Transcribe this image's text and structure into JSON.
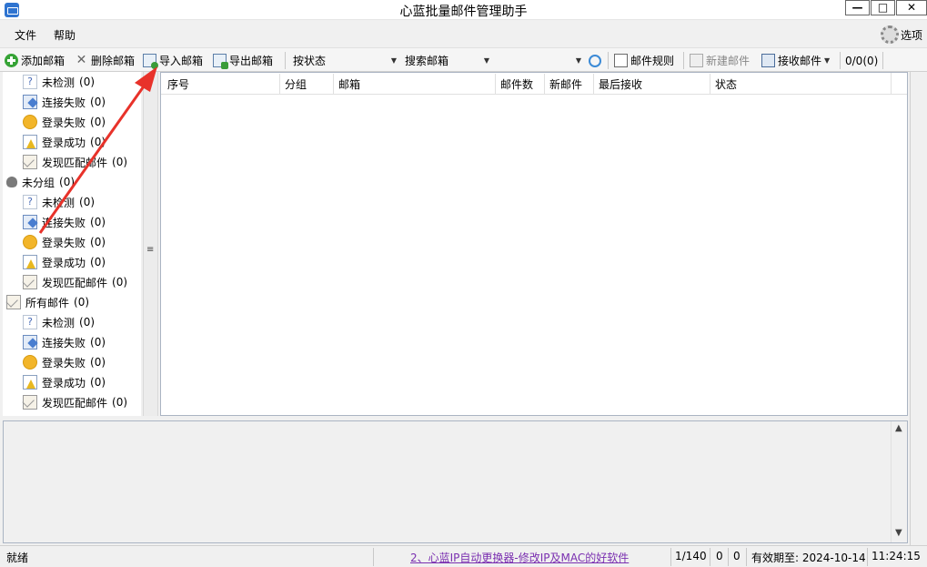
{
  "window": {
    "title": "心蓝批量邮件管理助手",
    "buttons": [
      "—",
      "□",
      "✕"
    ]
  },
  "menu": {
    "file": "文件",
    "help": "帮助",
    "options": "选项"
  },
  "toolbar": {
    "add_mailbox": "添加邮箱",
    "delete_mailbox": "删除邮箱",
    "import_mailbox": "导入邮箱",
    "export_mailbox": "导出邮箱",
    "status_filter": "按状态",
    "search_mailbox": "搜索邮箱",
    "search_value": "",
    "mail_rules": "邮件规则",
    "new_mail": "新建邮件",
    "receive_mail": "接收邮件",
    "count": "0/0(0)"
  },
  "tree": {
    "group1": [
      {
        "label": "未检测",
        "count": "(0)",
        "icon": "question-icon"
      },
      {
        "label": "连接失败",
        "count": "(0)",
        "icon": "link-icon"
      },
      {
        "label": "登录失败",
        "count": "(0)",
        "icon": "fail-icon"
      },
      {
        "label": "登录成功",
        "count": "(0)",
        "icon": "warning-icon"
      },
      {
        "label": "发现匹配邮件",
        "count": "(0)",
        "icon": "mail-icon"
      }
    ],
    "ungrouped": {
      "label": "未分组",
      "count": "(0)"
    },
    "group2": [
      {
        "label": "未检测",
        "count": "(0)",
        "icon": "question-icon"
      },
      {
        "label": "连接失败",
        "count": "(0)",
        "icon": "link-icon"
      },
      {
        "label": "登录失败",
        "count": "(0)",
        "icon": "fail-icon"
      },
      {
        "label": "登录成功",
        "count": "(0)",
        "icon": "warning-icon"
      },
      {
        "label": "发现匹配邮件",
        "count": "(0)",
        "icon": "mail-icon"
      }
    ],
    "all_mail": {
      "label": "所有邮件",
      "count": "(0)"
    },
    "group3": [
      {
        "label": "未检测",
        "count": "(0)",
        "icon": "question-icon"
      },
      {
        "label": "连接失败",
        "count": "(0)",
        "icon": "link-icon"
      },
      {
        "label": "登录失败",
        "count": "(0)",
        "icon": "fail-icon"
      },
      {
        "label": "登录成功",
        "count": "(0)",
        "icon": "warning-icon"
      },
      {
        "label": "发现匹配邮件",
        "count": "(0)",
        "icon": "mail-icon"
      }
    ]
  },
  "grid": {
    "columns": [
      "序号",
      "分组",
      "邮箱",
      "邮件数",
      "新邮件",
      "最后接收",
      "状态"
    ]
  },
  "status": {
    "ready": "就绪",
    "ad_link": "2、心蓝IP自动更换器-修改IP及MAC的好软件",
    "page": "1/140",
    "a": "0",
    "b": "0",
    "expiry": "有效期至: 2024-10-14",
    "time": "11:24:15"
  },
  "colors": {
    "arrow": "#e8322a",
    "link": "#7a2fb0",
    "accent": "#3b8ad6"
  }
}
